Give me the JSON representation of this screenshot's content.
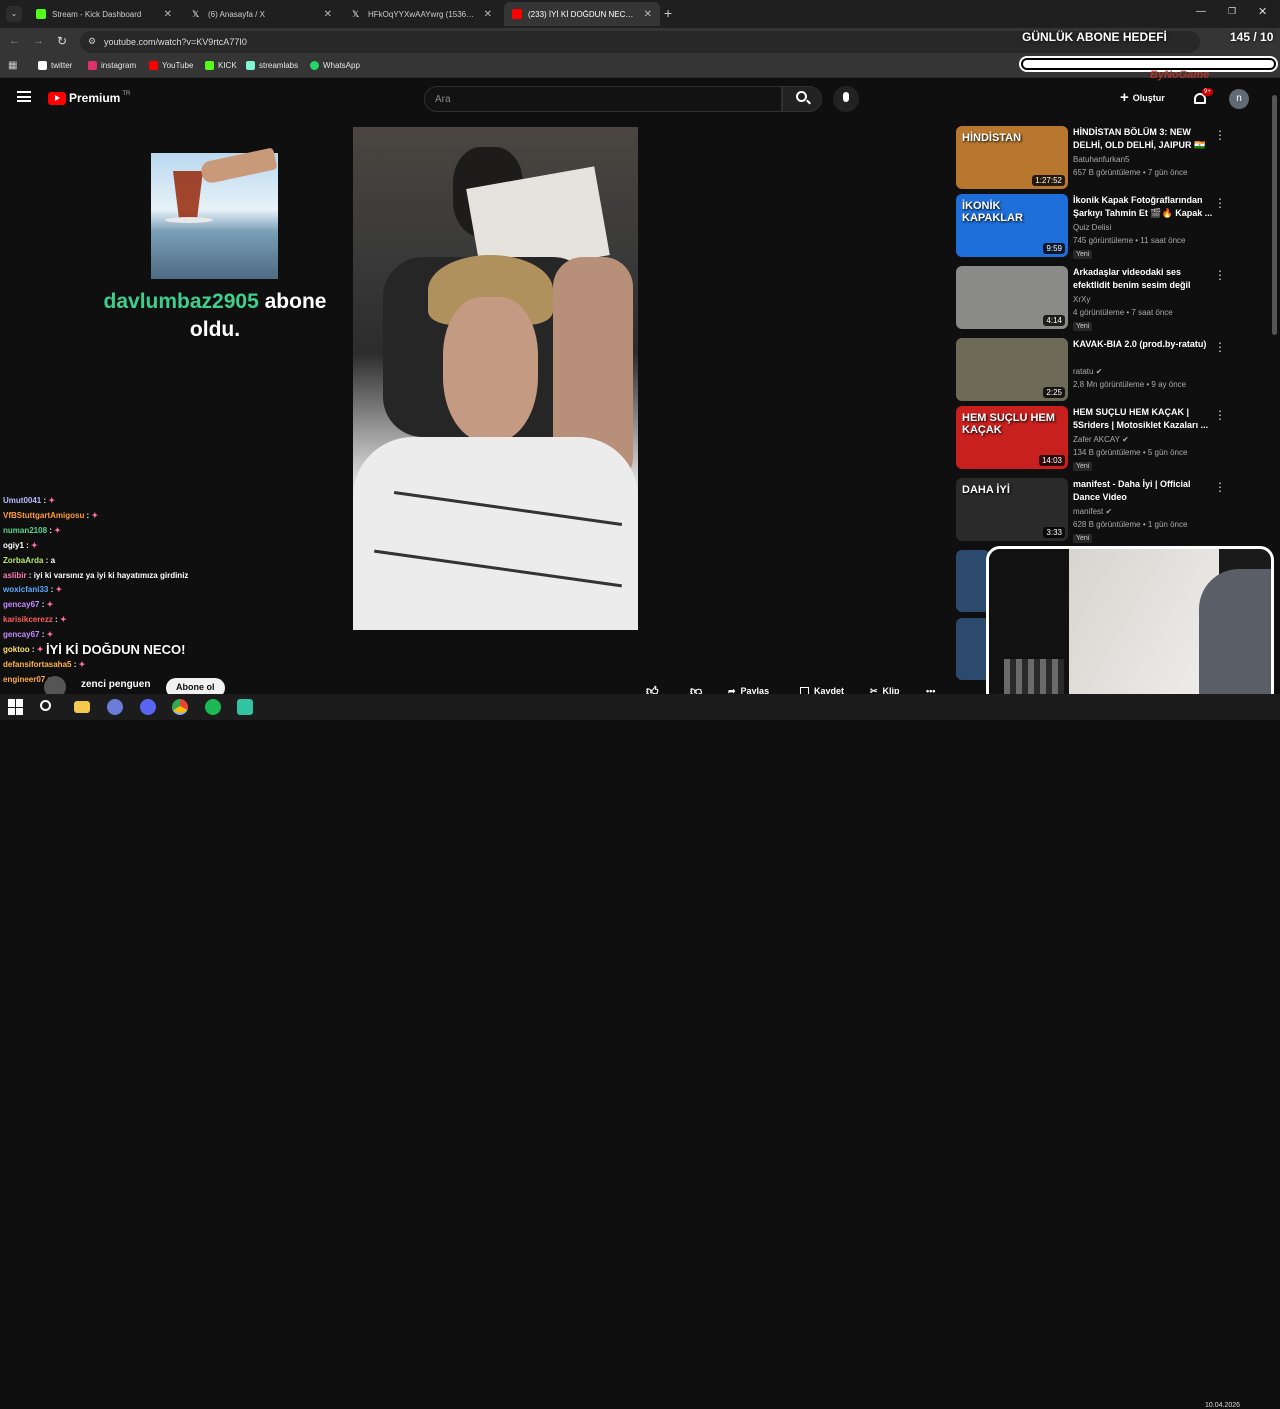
{
  "tabs": [
    {
      "title": "Stream - Kick Dashboard",
      "icon": "kick-icon",
      "color": "#53fc18"
    },
    {
      "title": "(6) Anasayfa / X",
      "icon": "x-icon",
      "color": "#ffffff"
    },
    {
      "title": "HFkOqYYXwAAYwrg (1536×2048)",
      "icon": "x-icon",
      "color": "#ffffff"
    },
    {
      "title": "(233) İYİ Kİ DOĞDUN NECO! - YouTube",
      "icon": "youtube-icon",
      "color": "#ff0000"
    }
  ],
  "address": "youtube.com/watch?v=KV9rtcA77I0",
  "bookmarks": [
    {
      "label": "twitter",
      "color": "#ffffff"
    },
    {
      "label": "instagram",
      "color": "#e1306c"
    },
    {
      "label": "YouTube",
      "color": "#ff0000"
    },
    {
      "label": "KICK",
      "color": "#53fc18"
    },
    {
      "label": "streamlabs",
      "color": "#80f5d2"
    },
    {
      "label": "WhatsApp",
      "color": "#25d366"
    }
  ],
  "youtube": {
    "logo": "Premium",
    "logo_sup": "TR",
    "search_placeholder": "Ara",
    "create_label": "Oluştur",
    "notif_count": "9+",
    "avatar_letter": "n"
  },
  "goal": {
    "title": "GÜNLÜK ABONE HEDEFİ",
    "count": "145 / 10",
    "progress": 1.0,
    "watermark": "ByNoGame"
  },
  "alert": {
    "username": "davlumbaz2905",
    "message": "abone oldu."
  },
  "chat": [
    {
      "user": "Umut0041",
      "msg": "",
      "color": "#b9b9ff"
    },
    {
      "user": "VfBStuttgartAmigosu",
      "msg": "",
      "color": "#ff9a3c"
    },
    {
      "user": "numan2108",
      "msg": "",
      "color": "#57d68d"
    },
    {
      "user": "ogiy1",
      "msg": "",
      "color": "#ffffff"
    },
    {
      "user": "ZorbaArda",
      "msg": "a",
      "color": "#b9e86b"
    },
    {
      "user": "aslibir",
      "msg": "iyi ki varsınız ya iyi ki hayatımıza girdiniz",
      "color": "#ff7ab6"
    },
    {
      "user": "woxicfani33",
      "msg": "",
      "color": "#5aa8ff"
    },
    {
      "user": "gencay67",
      "msg": "",
      "color": "#c58aff"
    },
    {
      "user": "karisikcerezz",
      "msg": "",
      "color": "#ff5c5c"
    },
    {
      "user": "gencay67",
      "msg": "",
      "color": "#c58aff"
    },
    {
      "user": "goktoo",
      "msg": "",
      "color": "#ffe066"
    },
    {
      "user": "defansifortasaha5",
      "msg": "",
      "color": "#ffb347"
    },
    {
      "user": "engineer07",
      "msg": "",
      "color": "#ffa94d"
    }
  ],
  "video_title": "İYİ Kİ DOĞDUN NECO!",
  "channel_name": "zenci penguen",
  "subscribe_label": "Abone ol",
  "actions": [
    {
      "label": "",
      "icon": "like-icon"
    },
    {
      "label": "",
      "icon": "dislike-icon"
    },
    {
      "label": "Paylaş",
      "icon": "share-icon"
    },
    {
      "label": "Kaydet",
      "icon": "save-icon"
    },
    {
      "label": "Klip",
      "icon": "clip-icon"
    }
  ],
  "recommendations": [
    {
      "title": "HİNDİSTAN BÖLÜM 3: NEW DELHİ, OLD DELHİ, JAIPUR 🇮🇳",
      "channel": "Batuhanfurkan5",
      "meta": "657 B görüntüleme • 7 gün önce",
      "duration": "1:27:52",
      "badge": "",
      "verified": false,
      "thumb": "#b8772f",
      "thumb_text": "HİNDİSTAN"
    },
    {
      "title": "İkonik Kapak Fotoğraflarından Şarkıyı Tahmin Et 🎬🔥 Kapak ...",
      "channel": "Quiz Delisi",
      "meta": "745 görüntüleme • 11 saat önce",
      "duration": "9:59",
      "badge": "Yeni",
      "verified": false,
      "thumb": "#1e6fd9",
      "thumb_text": "İKONİK KAPAKLAR"
    },
    {
      "title": "Arkadaşlar videodaki ses efektlidit benim sesim değil",
      "channel": "XrXy",
      "meta": "4 görüntüleme • 7 saat önce",
      "duration": "4:14",
      "badge": "Yeni",
      "verified": false,
      "thumb": "#8a8a88",
      "thumb_text": ""
    },
    {
      "title": "KAVAK-BIA 2.0 (prod.by-ratatu)",
      "channel": "ratatu",
      "meta": "2,8 Mn görüntüleme • 9 ay önce",
      "duration": "2:25",
      "badge": "",
      "verified": true,
      "thumb": "#6e6a58",
      "thumb_text": ""
    },
    {
      "title": "HEM SUÇLU HEM KAÇAK | 5Sriders | Motosiklet Kazaları ...",
      "channel": "Zafer AKCAY",
      "meta": "134 B görüntüleme • 5 gün önce",
      "duration": "14:03",
      "badge": "Yeni",
      "verified": true,
      "thumb": "#c8201e",
      "thumb_text": "HEM SUÇLU HEM KAÇAK"
    },
    {
      "title": "manifest - Daha İyi | Official Dance Video",
      "channel": "manifest",
      "meta": "628 B görüntüleme • 1 gün önce",
      "duration": "3:33",
      "badge": "Yeni",
      "verified": true,
      "thumb": "#2a2a2a",
      "thumb_text": "DAHA İYİ"
    }
  ],
  "taskbar": {
    "date": "10.04.2026"
  }
}
